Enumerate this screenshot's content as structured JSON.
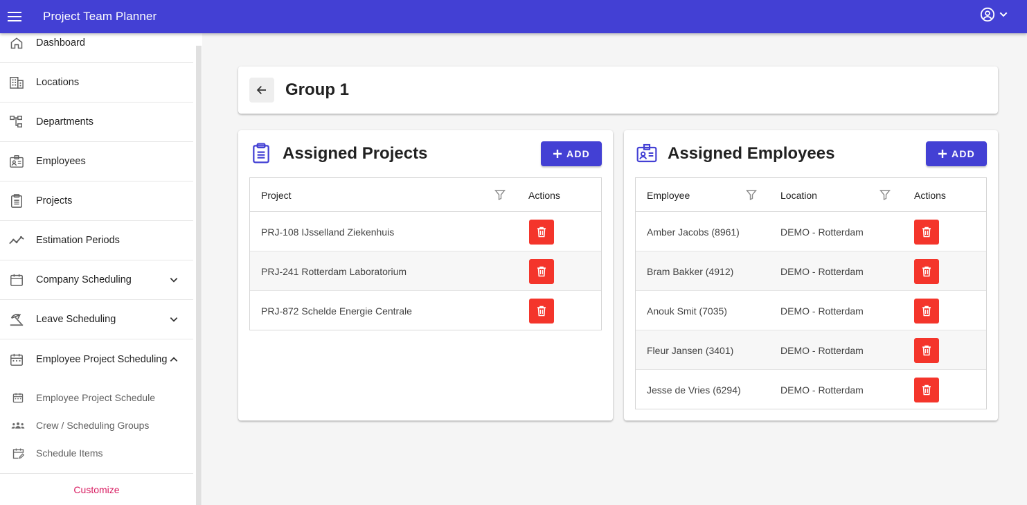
{
  "app": {
    "title": "Project Team Planner"
  },
  "sidebar": {
    "items": [
      {
        "label": "Dashboard",
        "icon": "home-icon"
      },
      {
        "label": "Locations",
        "icon": "building-icon"
      },
      {
        "label": "Departments",
        "icon": "hierarchy-icon"
      },
      {
        "label": "Employees",
        "icon": "badge-icon"
      },
      {
        "label": "Projects",
        "icon": "clipboard-icon"
      },
      {
        "label": "Estimation Periods",
        "icon": "trend-icon"
      },
      {
        "label": "Company Scheduling",
        "icon": "calendar-icon",
        "expandable": true,
        "expanded": false
      },
      {
        "label": "Leave Scheduling",
        "icon": "beach-icon",
        "expandable": true,
        "expanded": false
      },
      {
        "label": "Employee Project Scheduling",
        "icon": "calendar-icon",
        "expandable": true,
        "expanded": true
      }
    ],
    "subitems": [
      {
        "label": "Employee Project Schedule",
        "icon": "calendar-small-icon"
      },
      {
        "label": "Crew / Scheduling Groups",
        "icon": "group-icon"
      },
      {
        "label": "Schedule Items",
        "icon": "calendar-edit-icon"
      }
    ],
    "customize_label": "Customize"
  },
  "page": {
    "title": "Group 1"
  },
  "projects_panel": {
    "title": "Assigned Projects",
    "add_label": "ADD",
    "columns": [
      "Project",
      "Actions"
    ],
    "rows": [
      {
        "project": "PRJ-108 IJsselland Ziekenhuis"
      },
      {
        "project": "PRJ-241 Rotterdam Laboratorium"
      },
      {
        "project": "PRJ-872 Schelde Energie Centrale"
      }
    ]
  },
  "employees_panel": {
    "title": "Assigned Employees",
    "add_label": "ADD",
    "columns": [
      "Employee",
      "Location",
      "Actions"
    ],
    "rows": [
      {
        "employee": "Amber Jacobs (8961)",
        "location": "DEMO - Rotterdam"
      },
      {
        "employee": "Bram Bakker (4912)",
        "location": "DEMO - Rotterdam"
      },
      {
        "employee": "Anouk Smit (7035)",
        "location": "DEMO - Rotterdam"
      },
      {
        "employee": "Fleur Jansen (3401)",
        "location": "DEMO - Rotterdam"
      },
      {
        "employee": "Jesse de Vries (6294)",
        "location": "DEMO - Rotterdam"
      }
    ]
  },
  "colors": {
    "primary": "#4340d4",
    "danger": "#f4352b",
    "accent": "#d81b60"
  }
}
